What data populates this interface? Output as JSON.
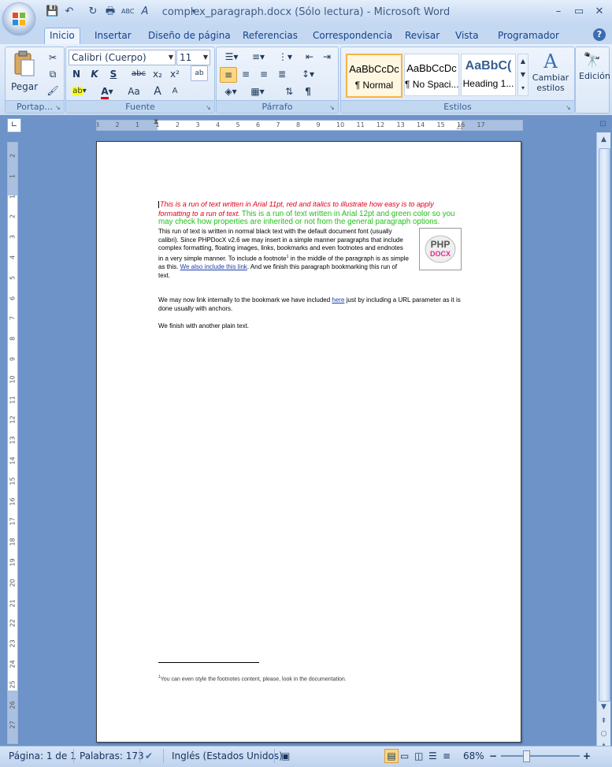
{
  "window": {
    "title": "complex_paragraph.docx (Sólo lectura) - Microsoft Word",
    "controls": {
      "minimize": "–",
      "maximize": "▭",
      "close": "✕"
    }
  },
  "quick_access": {
    "save": "💾",
    "undo": "↶",
    "redo": "↻",
    "print": "🖶",
    "spell": "ABC",
    "format": "A"
  },
  "tabs": [
    "Inicio",
    "Insertar",
    "Diseño de página",
    "Referencias",
    "Correspondencia",
    "Revisar",
    "Vista",
    "Programador"
  ],
  "ribbon": {
    "clipboard": {
      "label": "Portap...",
      "paste": "Pegar"
    },
    "font": {
      "label": "Fuente",
      "font_name": "Calibri (Cuerpo)",
      "font_size": "11",
      "bold": "N",
      "italic": "K",
      "underline": "S",
      "strike": "abc",
      "sub": "x₂",
      "sup": "x²",
      "grow": "A",
      "shrink": "A",
      "case": "Aa"
    },
    "paragraph": {
      "label": "Párrafo",
      "pilcrow": "¶"
    },
    "styles": {
      "label": "Estilos",
      "tiles": [
        {
          "sample": "AaBbCcDc",
          "name": "¶ Normal"
        },
        {
          "sample": "AaBbCcDc",
          "name": "¶ No Spaci..."
        },
        {
          "sample": "AaBbC(",
          "name": "Heading 1..."
        }
      ],
      "change": "Cambiar estilos"
    },
    "editing": {
      "label": "Edición"
    }
  },
  "ruler": {
    "h_numbers": [
      "3",
      "2",
      "1",
      "1",
      "2",
      "3",
      "4",
      "5",
      "6",
      "7",
      "8",
      "9",
      "10",
      "11",
      "12",
      "13",
      "14",
      "15",
      "16",
      "17"
    ],
    "v_numbers": [
      "2",
      "1",
      "1",
      "2",
      "3",
      "4",
      "5",
      "6",
      "7",
      "8",
      "9",
      "10",
      "11",
      "12",
      "13",
      "14",
      "15",
      "16",
      "17",
      "18",
      "19",
      "20",
      "21",
      "22",
      "23",
      "24",
      "25",
      "26",
      "27"
    ]
  },
  "document": {
    "p1_red": "This is a run of text written in Arial 11pt, red and italics to illustrate how easy is to apply formatting to a run of text.",
    "p1_green": "This is a run of text written in Arial 12pt and green color so you may check how properties are inherited or not from the general paragraph options.",
    "p1_black_a": "This run of text is written in normal black text with the default document font (usually calibri). Since PHPDocX v2.6 we may insert in a simple manner paragraphs that include complex formatting, floating images, links, bookmarks and even footnotes and endnotes in a very simple manner. To include a footnote",
    "p1_fn_mark": "1",
    "p1_black_b": " in the middle of the paragraph is as simple as this.",
    "p1_link": "We also include this link",
    "p1_black_c": ". And we finish this paragraph bookmarking this run of text.",
    "p2_a": "We may now link internally to the bookmark we have included ",
    "p2_link": "here",
    "p2_b": " just by including a URL parameter as it is done usually with anchors.",
    "p3": "We finish with another plain text.",
    "logo_top": "PHP",
    "logo_bottom": "DOCX",
    "footnote_mark": "1",
    "footnote_text": "You can even style the footnotes content, please, look in the documentation."
  },
  "status": {
    "page": "Página: 1 de 1",
    "words": "Palabras: 173",
    "language": "Inglés (Estados Unidos)",
    "zoom": "68%",
    "zoom_minus": "−",
    "zoom_plus": "+"
  }
}
